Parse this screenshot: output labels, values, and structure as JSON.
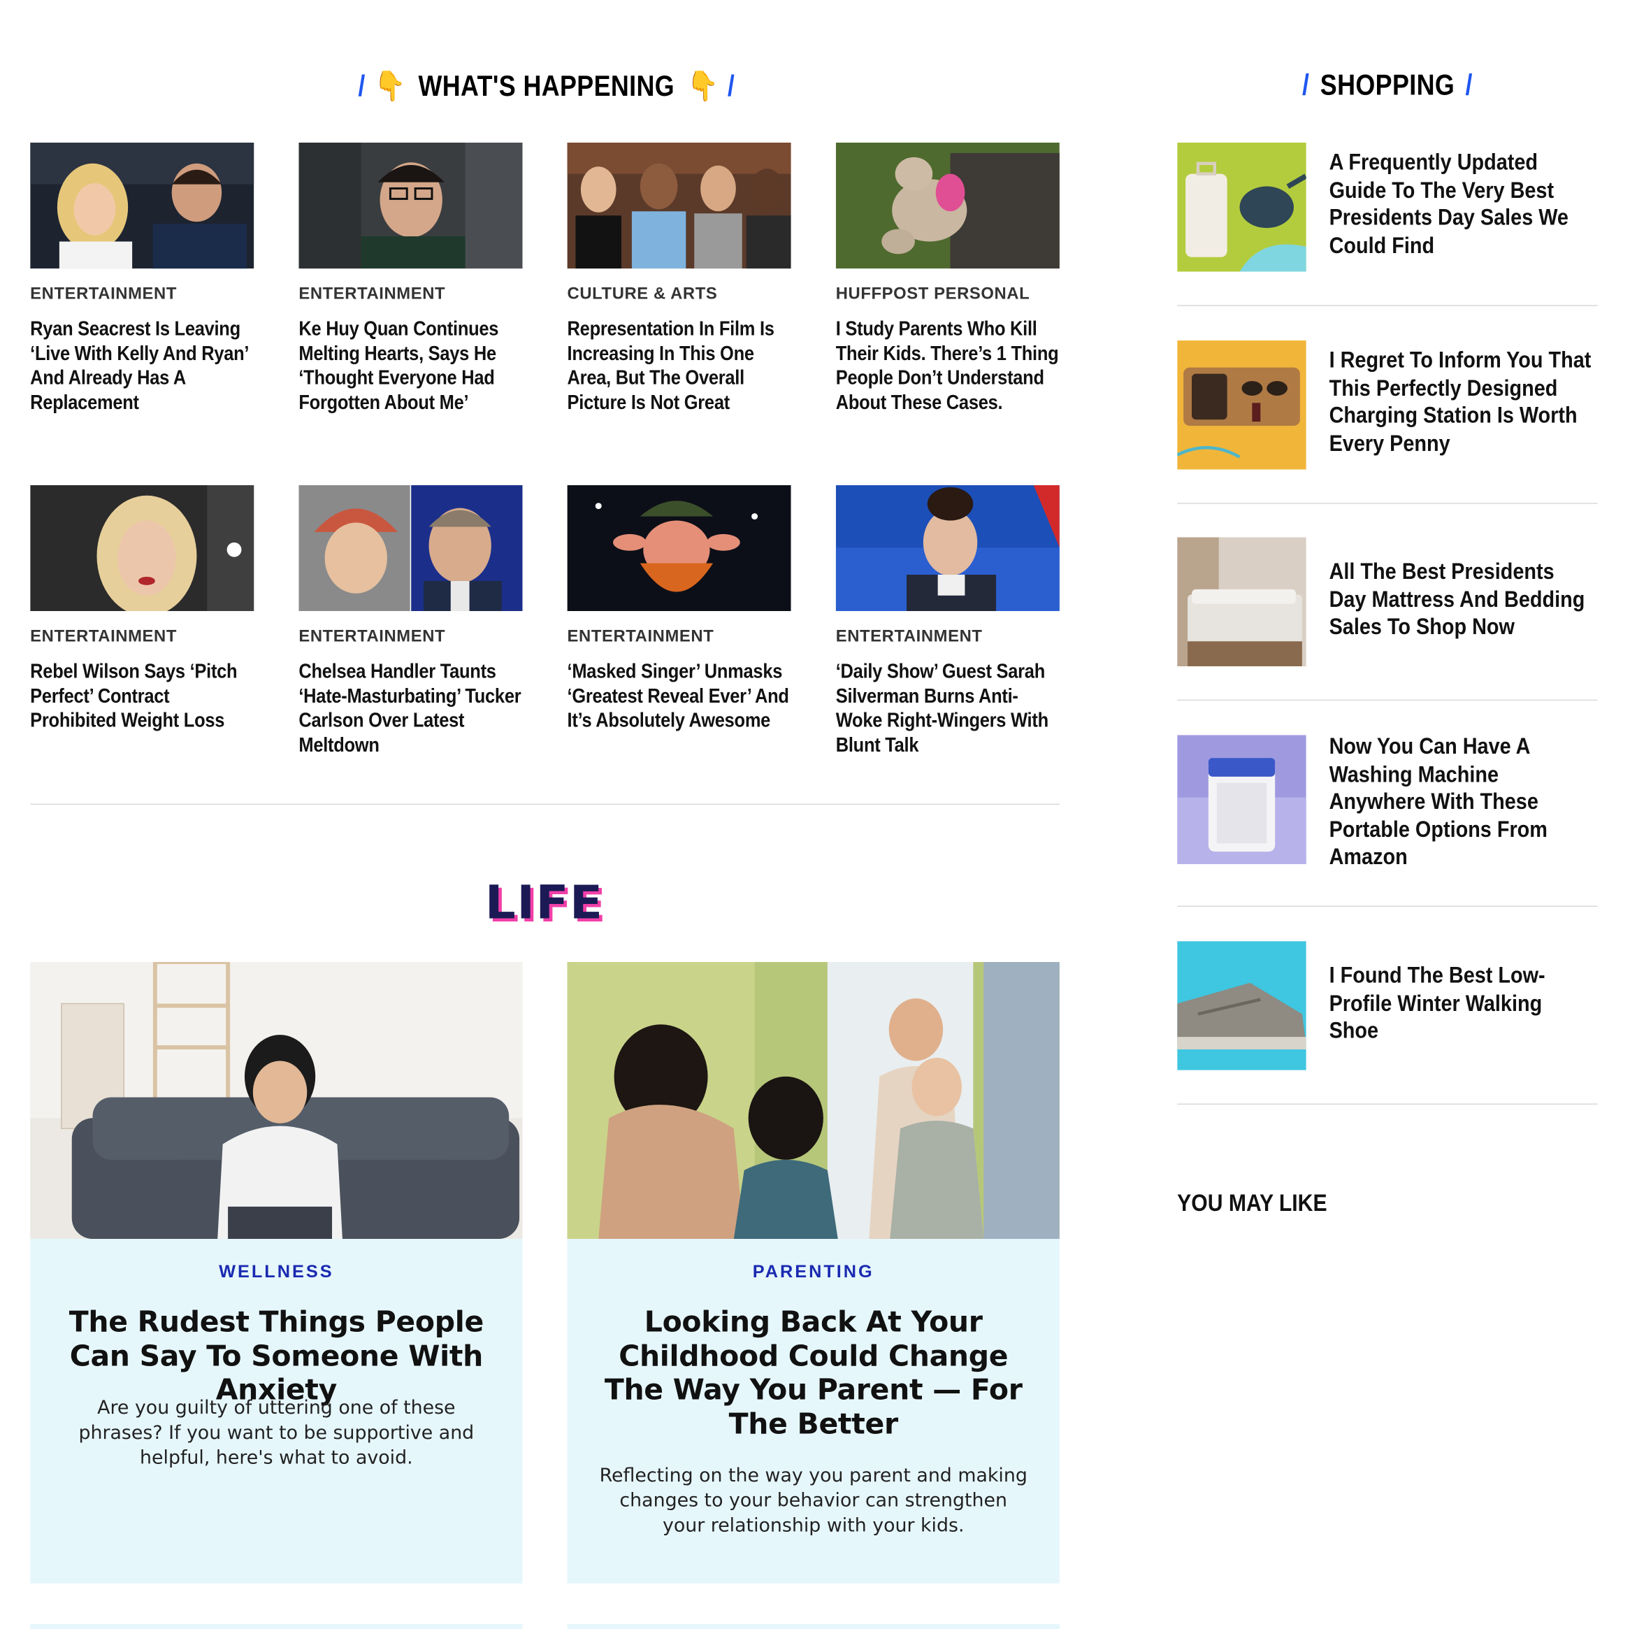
{
  "whats_happening": {
    "title": "WHAT'S HAPPENING",
    "hand_glyph": "👇",
    "slash": "/",
    "cards": [
      {
        "kicker": "ENTERTAINMENT",
        "headline": "Ryan Seacrest Is Leaving ‘Live With Kelly And Ryan’ And Already Has A Replacement"
      },
      {
        "kicker": "ENTERTAINMENT",
        "headline": "Ke Huy Quan Continues Melting Hearts, Says He ‘Thought Everyone Had Forgotten About Me’"
      },
      {
        "kicker": "CULTURE & ARTS",
        "headline": "Representation In Film Is Increasing In This One Area, But The Overall Picture Is Not Great"
      },
      {
        "kicker": "HUFFPOST PERSONAL",
        "headline": "I Study Parents Who Kill Their Kids. There’s 1 Thing People Don’t Understand About These Cases."
      },
      {
        "kicker": "ENTERTAINMENT",
        "headline": "Rebel Wilson Says ‘Pitch Perfect’ Contract Prohibited Weight Loss"
      },
      {
        "kicker": "ENTERTAINMENT",
        "headline": "Chelsea Handler Taunts ‘Hate-Masturbating’ Tucker Carlson Over Latest Meltdown"
      },
      {
        "kicker": "ENTERTAINMENT",
        "headline": "‘Masked Singer’ Unmasks ‘Greatest Reveal Ever’ And It’s Absolutely Awesome"
      },
      {
        "kicker": "ENTERTAINMENT",
        "headline": "‘Daily Show’ Guest Sarah Silverman Burns Anti-Woke Right-Wingers With Blunt Talk"
      }
    ]
  },
  "life": {
    "title": "LIFE",
    "cards": [
      {
        "kicker": "WELLNESS",
        "headline": "The Rudest Things People Can Say To Someone With Anxiety",
        "description": "Are you guilty of uttering one of these phrases? If you want to be supportive and helpful, here's what to avoid."
      },
      {
        "kicker": "PARENTING",
        "headline": "Looking Back At Your Childhood Could Change The Way You Parent — For The Better",
        "description": "Reflecting on the way you parent and making changes to your behavior can strengthen your relationship with your kids."
      }
    ]
  },
  "shopping": {
    "title": "SHOPPING",
    "slash": "/",
    "items": [
      {
        "headline": "A Frequently Updated Guide To The Very Best Presidents Day Sales We Could Find"
      },
      {
        "headline": "I Regret To Inform You That This Perfectly Designed Charging Station Is Worth Every Penny"
      },
      {
        "headline": "All The Best Presidents Day Mattress And Bedding Sales To Shop Now"
      },
      {
        "headline": "Now You Can Have A Washing Machine Anywhere With These Portable Options From Amazon"
      },
      {
        "headline": "I Found The Best Low-Profile Winter Walking Shoe"
      }
    ]
  },
  "you_may_like": {
    "title": "YOU MAY LIKE"
  },
  "colors": {
    "accent_blue": "#1e56f0",
    "life_navy": "#1b1a55",
    "life_pink": "#f23fa8",
    "card_bg": "#e6f7fc",
    "kicker_blue": "#1a2ab0"
  }
}
